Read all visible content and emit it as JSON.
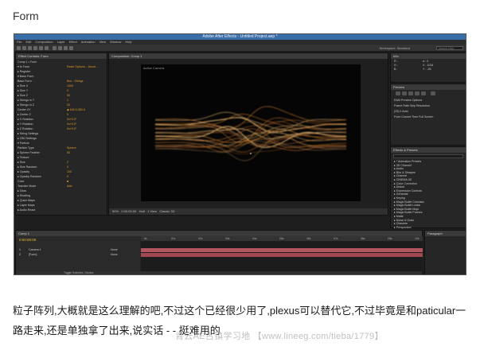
{
  "post": {
    "title": "Form",
    "caption": "粒子阵列,大概就是这么理解的吧,不过这个已经很少用了,plexus可以替代它,不过毕竟是和paticular一路走来,还是单独拿了出来,说实话 - - 挺难用的",
    "watermark": "青云AE古镇学习地 【www.lineeg.com/tieba/1779】"
  },
  "ae": {
    "window_title": "Adobe After Effects - Untitled Project.aep *",
    "menu": [
      "File",
      "Edit",
      "Composition",
      "Layer",
      "Effect",
      "Animation",
      "View",
      "Window",
      "Help"
    ],
    "toolbar": {
      "workspace": "Workspace: Standard",
      "search_placeholder": "Search Help"
    },
    "effect_controls": {
      "tab": "Effect Controls: Form",
      "rows": [
        {
          "label": "Comp 1 • Form",
          "value": ""
        },
        {
          "label": "▾ fx  Form",
          "value": "Reset  Options...  About..."
        },
        {
          "label": "  ▸ Register",
          "value": ""
        },
        {
          "label": "  ▾ Base Form",
          "value": ""
        },
        {
          "label": "      Base Form",
          "value": "Box - Strings"
        },
        {
          "label": "    ▸ Size X",
          "value": "1000"
        },
        {
          "label": "    ▸ Size Y",
          "value": "0"
        },
        {
          "label": "    ▸ Size Z",
          "value": "50"
        },
        {
          "label": "    ▸ Strings in Y",
          "value": "1"
        },
        {
          "label": "    ▸ Strings in Z",
          "value": "20"
        },
        {
          "label": "      Center XY",
          "value": "◆ 640.0,360.0"
        },
        {
          "label": "    ▸ Center Z",
          "value": "0"
        },
        {
          "label": "    ▸ X Rotation",
          "value": "0x+0.0°"
        },
        {
          "label": "    ▸ Y Rotation",
          "value": "0x+0.0°"
        },
        {
          "label": "    ▸ Z Rotation",
          "value": "0x+0.0°"
        },
        {
          "label": "    ▸ String Settings",
          "value": ""
        },
        {
          "label": "    ▸ OBJ Settings",
          "value": ""
        },
        {
          "label": "  ▾ Particle",
          "value": ""
        },
        {
          "label": "      Particle Type",
          "value": "Sphere"
        },
        {
          "label": "    ▸ Sphere Feather",
          "value": "50"
        },
        {
          "label": "    ▸ Texture",
          "value": ""
        },
        {
          "label": "    ▸ Size",
          "value": "2"
        },
        {
          "label": "    ▸ Size Random",
          "value": "0"
        },
        {
          "label": "    ▸ Opacity",
          "value": "100"
        },
        {
          "label": "    ▸ Opacity Random",
          "value": "0"
        },
        {
          "label": "      Color",
          "value": "■"
        },
        {
          "label": "      Transfer Mode",
          "value": "Add"
        },
        {
          "label": "    ▸ Glow",
          "value": ""
        },
        {
          "label": "  ▸ Shading",
          "value": ""
        },
        {
          "label": "  ▸ Quick Maps",
          "value": ""
        },
        {
          "label": "  ▸ Layer Maps",
          "value": ""
        },
        {
          "label": "  ▸ Audio React",
          "value": ""
        }
      ]
    },
    "composition": {
      "tab": "Composition: Comp 1",
      "camera_label": "Active Camera",
      "zoom": "50%",
      "timecode": "0:00:00:00",
      "resolution": "Half",
      "view": "1 View",
      "renderer": "Classic 3D"
    },
    "info_panel": {
      "tab": "Info",
      "lines": [
        "R :",
        "G :",
        "B :",
        "A : 0",
        "X : 1034",
        "Y : -26"
      ]
    },
    "preview_panel": {
      "tab": "Preview",
      "lines": [
        "RAM Preview Options",
        "Frame Rate  Skip  Resolution",
        "(25)    0    Auto",
        "From Current Time   Full Screen"
      ]
    },
    "effects_panel": {
      "tab": "Effects & Presets",
      "items": [
        "▸ * Animation Presets",
        "▸ 3D Channel",
        "▸ Audio",
        "▸ Blur & Sharpen",
        "▸ Channel",
        "▸ CINEMA 4D",
        "▸ Color Correction",
        "▸ Distort",
        "▸ Expression Controls",
        "▸ Generate",
        "▸ Keying",
        "▸ Magic Bullet Colorista",
        "▸ Magic Bullet Looks",
        "▸ Magic Bullet Mojo",
        "▸ Magic Bullet Frames",
        "▸ Matte",
        "▸ Noise & Grain",
        "▸ Obsolete",
        "▸ Perspective"
      ]
    },
    "paragraph_panel": {
      "tab": "Paragraph"
    },
    "timeline": {
      "tab": "Comp 1",
      "timecode": "0:00:00:00",
      "layers": [
        {
          "num": "1",
          "name": "Camera 1",
          "mode": "None"
        },
        {
          "num": "2",
          "name": "[Form]",
          "mode": "None"
        }
      ],
      "ticks": [
        "0s",
        "01s",
        "02s",
        "03s",
        "04s",
        "05s",
        "06s",
        "07s",
        "08s",
        "09s",
        "10s"
      ],
      "toggle_label": "Toggle Switches / Modes"
    },
    "colors": {
      "accent": "#e8a23a",
      "track": "#b4545e",
      "titlebar": "#3a6ea8"
    }
  }
}
